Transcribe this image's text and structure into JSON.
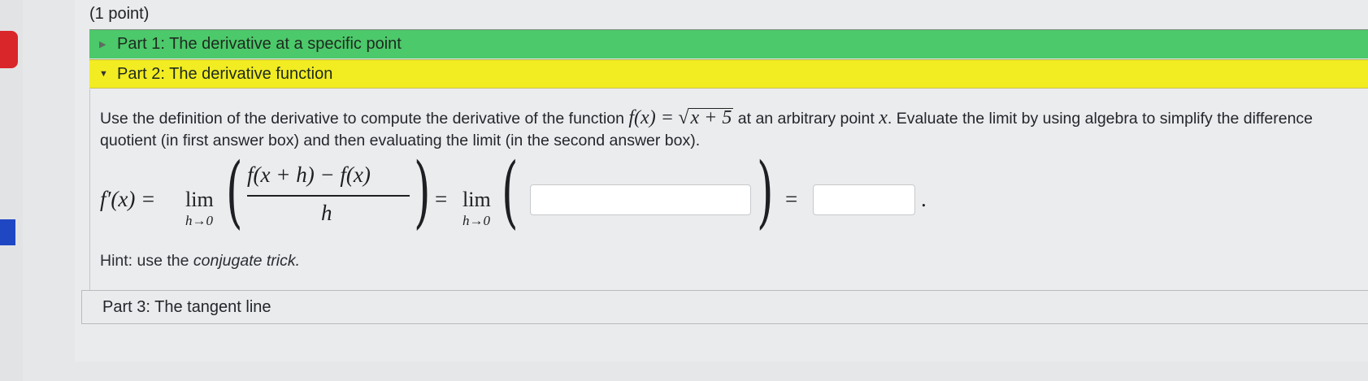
{
  "problem": {
    "points": "(1 point)"
  },
  "parts": {
    "part1": {
      "label": "Part 1: The derivative at a specific point",
      "collapsed": true,
      "color": "#4cc96a"
    },
    "part2": {
      "label": "Part 2: The derivative function",
      "collapsed": false,
      "color": "#f2ec22"
    },
    "part3": {
      "label": "Part 3: The tangent line"
    }
  },
  "part2_body": {
    "instruction_start": "Use the definition of the derivative to compute the derivative of the function",
    "function_lhs": "f(x) =",
    "function_sqrt": "x + 5",
    "instruction_mid": "at an arbitrary point",
    "point_var": "x",
    "instruction_end": ". Evaluate the limit by using algebra to simplify the difference quotient (in first answer box) and then evaluating the limit (in the second answer box).",
    "equation": {
      "lhs": "f′(x) =",
      "lim": "lim",
      "lim_sub": "h→0",
      "numerator": "f(x + h) − f(x)",
      "denominator": "h",
      "equals": "=",
      "lim2": "lim",
      "lim2_sub": "h→0",
      "equals2": "=",
      "period": "."
    },
    "answer_box_1": {
      "value": ""
    },
    "answer_box_2": {
      "value": ""
    },
    "hint_prefix": "Hint: use the",
    "hint_emphasis": "conjugate trick."
  }
}
